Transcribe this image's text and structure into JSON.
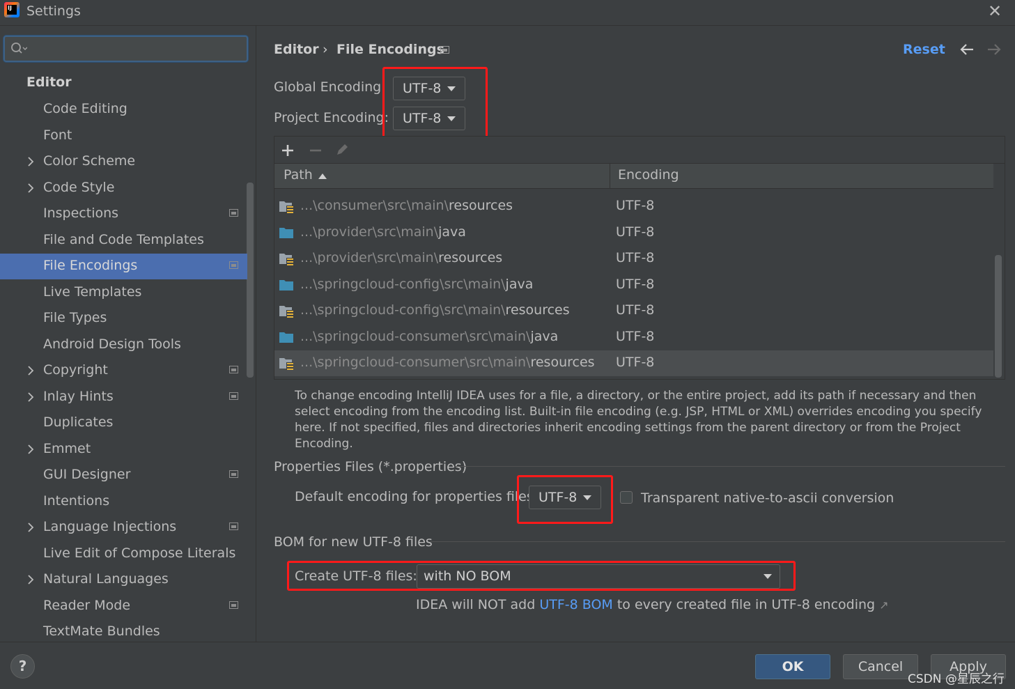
{
  "window": {
    "title": "Settings",
    "app_icon_text": "IJ"
  },
  "sidebar": {
    "search_placeholder": "",
    "header": "Editor",
    "items": [
      {
        "label": "Code Editing",
        "chevron": false,
        "project": false
      },
      {
        "label": "Font",
        "chevron": false,
        "project": false
      },
      {
        "label": "Color Scheme",
        "chevron": true,
        "project": false
      },
      {
        "label": "Code Style",
        "chevron": true,
        "project": false
      },
      {
        "label": "Inspections",
        "chevron": false,
        "project": true
      },
      {
        "label": "File and Code Templates",
        "chevron": false,
        "project": false
      },
      {
        "label": "File Encodings",
        "chevron": false,
        "project": true,
        "selected": true
      },
      {
        "label": "Live Templates",
        "chevron": false,
        "project": false
      },
      {
        "label": "File Types",
        "chevron": false,
        "project": false
      },
      {
        "label": "Android Design Tools",
        "chevron": false,
        "project": false
      },
      {
        "label": "Copyright",
        "chevron": true,
        "project": true
      },
      {
        "label": "Inlay Hints",
        "chevron": true,
        "project": true
      },
      {
        "label": "Duplicates",
        "chevron": false,
        "project": false
      },
      {
        "label": "Emmet",
        "chevron": true,
        "project": false
      },
      {
        "label": "GUI Designer",
        "chevron": false,
        "project": true
      },
      {
        "label": "Intentions",
        "chevron": false,
        "project": false
      },
      {
        "label": "Language Injections",
        "chevron": true,
        "project": true
      },
      {
        "label": "Live Edit of Compose Literals",
        "chevron": false,
        "project": false
      },
      {
        "label": "Natural Languages",
        "chevron": true,
        "project": false
      },
      {
        "label": "Reader Mode",
        "chevron": false,
        "project": true
      },
      {
        "label": "TextMate Bundles",
        "chevron": false,
        "project": false
      }
    ]
  },
  "breadcrumb": {
    "parent": "Editor",
    "separator": "›",
    "current": "File Encodings"
  },
  "header": {
    "reset": "Reset",
    "back_icon": "arrow-left-icon",
    "forward_icon": "arrow-right-icon"
  },
  "encodings": {
    "global_label": "Global Encoding:",
    "global_value": "UTF-8",
    "project_label": "Project Encoding:",
    "project_value": "UTF-8"
  },
  "table": {
    "columns": {
      "path": "Path",
      "encoding": "Encoding"
    },
    "rows": [
      {
        "prefix": "...\\consumer\\src\\main\\",
        "tail": "resources",
        "encoding": "UTF-8",
        "icon": "resources-folder-icon"
      },
      {
        "prefix": "...\\provider\\src\\main\\",
        "tail": "java",
        "encoding": "UTF-8",
        "icon": "source-folder-icon"
      },
      {
        "prefix": "...\\provider\\src\\main\\",
        "tail": "resources",
        "encoding": "UTF-8",
        "icon": "resources-folder-icon"
      },
      {
        "prefix": "...\\springcloud-config\\src\\main\\",
        "tail": "java",
        "encoding": "UTF-8",
        "icon": "source-folder-icon"
      },
      {
        "prefix": "...\\springcloud-config\\src\\main\\",
        "tail": "resources",
        "encoding": "UTF-8",
        "icon": "resources-folder-icon"
      },
      {
        "prefix": "...\\springcloud-consumer\\src\\main\\",
        "tail": "java",
        "encoding": "UTF-8",
        "icon": "source-folder-icon"
      },
      {
        "prefix": "...\\springcloud-consumer\\src\\main\\",
        "tail": "resources",
        "encoding": "UTF-8",
        "icon": "resources-folder-icon",
        "selected": true
      }
    ]
  },
  "help_text": "To change encoding IntelliJ IDEA uses for a file, a directory, or the entire project, add its path if necessary and then select encoding from the encoding list. Built-in file encoding (e.g. JSP, HTML or XML) overrides encoding you specify here. If not specified, files and directories inherit encoding settings from the parent directory or from the Project Encoding.",
  "properties": {
    "section_title": "Properties Files (*.properties)",
    "default_label": "Default encoding for properties files:",
    "default_value": "UTF-8",
    "transparent_label": "Transparent native-to-ascii conversion",
    "transparent_checked": false
  },
  "bom": {
    "section_title": "BOM for new UTF-8 files",
    "create_label": "Create UTF-8 files:",
    "create_value": "with NO BOM",
    "note_before": "IDEA will NOT add ",
    "note_link": "UTF-8 BOM",
    "note_after": " to every created file in UTF-8 encoding",
    "note_arrow": "↗"
  },
  "footer": {
    "help": "?",
    "ok": "OK",
    "cancel": "Cancel",
    "apply": "Apply",
    "watermark": "CSDN @星辰之行"
  },
  "colors": {
    "accent": "#4b6eaf",
    "link": "#589df6",
    "highlight_box": "#ff1a1a",
    "background": "#3c3f41"
  }
}
